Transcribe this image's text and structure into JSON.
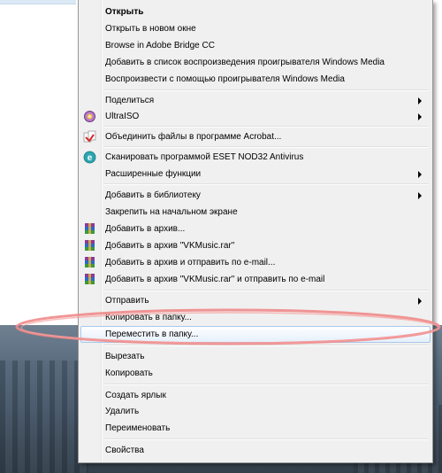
{
  "menu": {
    "items": [
      {
        "label": "Открыть",
        "bold": true
      },
      {
        "label": "Открыть в новом окне"
      },
      {
        "label": "Browse in Adobe Bridge CC"
      },
      {
        "label": "Добавить в список воспроизведения проигрывателя Windows Media"
      },
      {
        "label": "Воспроизвести с помощью проигрывателя Windows Media"
      },
      {
        "label": "Поделиться",
        "submenu": true
      },
      {
        "label": "UltraISO",
        "submenu": true,
        "icon": "ultraiso-icon"
      },
      {
        "label": "Объединить файлы в программе Acrobat...",
        "icon": "acrobat-icon"
      },
      {
        "label": "Сканировать программой ESET NOD32 Antivirus",
        "icon": "eset-icon"
      },
      {
        "label": "Расширенные функции",
        "submenu": true
      },
      {
        "label": "Добавить в библиотеку",
        "submenu": true
      },
      {
        "label": "Закрепить на начальном экране"
      },
      {
        "label": "Добавить в архив...",
        "icon": "winrar-icon"
      },
      {
        "label": "Добавить в архив \"VKMusic.rar\"",
        "icon": "winrar-icon"
      },
      {
        "label": "Добавить в архив и отправить по e-mail...",
        "icon": "winrar-icon"
      },
      {
        "label": "Добавить в архив \"VKMusic.rar\" и отправить по e-mail",
        "icon": "winrar-icon"
      },
      {
        "label": "Отправить",
        "submenu": true
      },
      {
        "label": "Копировать в папку..."
      },
      {
        "label": "Переместить в папку...",
        "highlighted": true
      },
      {
        "label": "Вырезать"
      },
      {
        "label": "Копировать"
      },
      {
        "label": "Создать ярлык"
      },
      {
        "label": "Удалить"
      },
      {
        "label": "Переименовать"
      },
      {
        "label": "Свойства"
      }
    ]
  },
  "colors": {
    "menu_background": "#f0f0f0",
    "highlight": "#e6f0fb",
    "annotation_ellipse": "#f08a8a"
  }
}
